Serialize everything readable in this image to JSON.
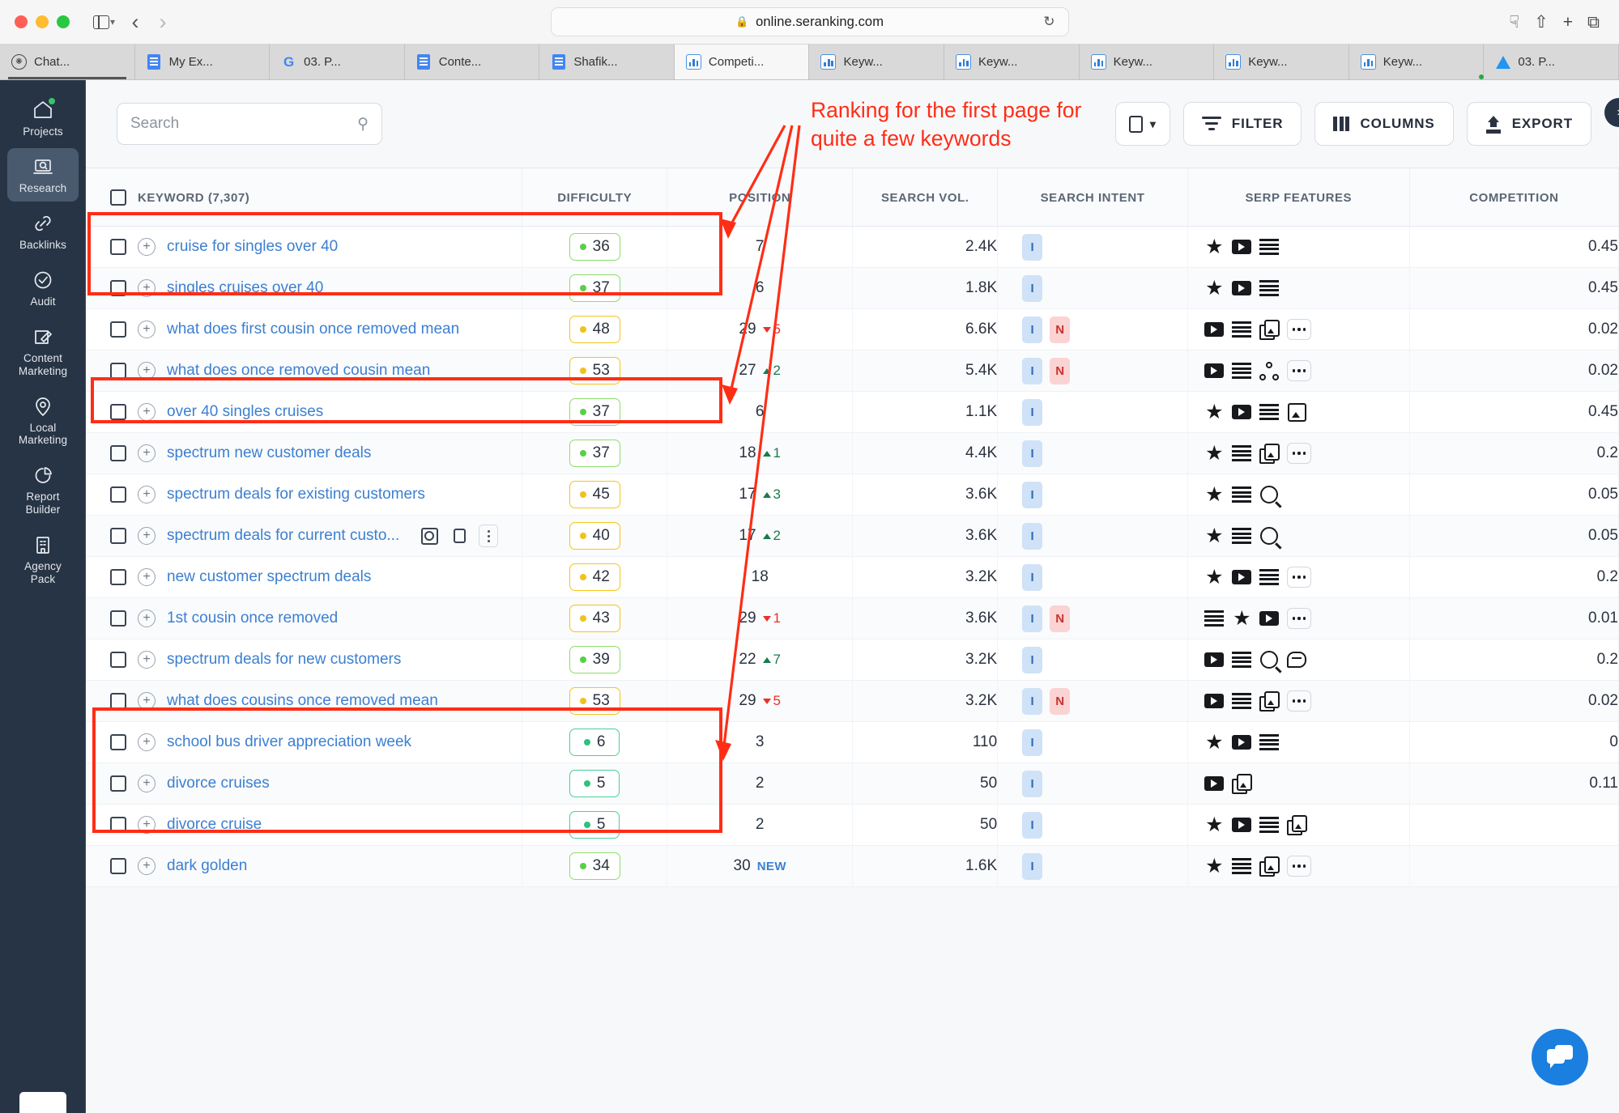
{
  "browser": {
    "url": "online.seranking.com",
    "lock_icon": "lock-icon",
    "reload_icon": "reload-icon",
    "download_icon": "download-icon",
    "share_icon": "share-icon",
    "new_tab_icon": "plus-icon",
    "tabs_overview_icon": "tabs-overview-icon",
    "back_icon": "back-arrow-icon",
    "forward_icon": "forward-arrow-icon",
    "sidebar_icon": "sidebar-toggle-icon",
    "tabs": [
      {
        "label": "Chat...",
        "favicon": "chatgpt-icon",
        "active": false
      },
      {
        "label": "My Ex...",
        "favicon": "google-docs-icon",
        "active": false
      },
      {
        "label": "03. P...",
        "favicon": "google-icon",
        "active": false
      },
      {
        "label": "Conte...",
        "favicon": "google-docs-icon",
        "active": false
      },
      {
        "label": "Shafik...",
        "favicon": "google-docs-icon",
        "active": false
      },
      {
        "label": "Competi...",
        "favicon": "chart-icon",
        "active": true
      },
      {
        "label": "Keyw...",
        "favicon": "chart-icon",
        "active": false
      },
      {
        "label": "Keyw...",
        "favicon": "chart-icon",
        "active": false
      },
      {
        "label": "Keyw...",
        "favicon": "chart-icon",
        "active": false
      },
      {
        "label": "Keyw...",
        "favicon": "chart-icon",
        "active": false
      },
      {
        "label": "Keyw...",
        "favicon": "chart-icon",
        "active": false
      },
      {
        "label": "03. P...",
        "favicon": "google-drive-icon",
        "active": false
      }
    ]
  },
  "sidebar": {
    "collapse_icon": "chevron-right-icon",
    "items": [
      {
        "label": "Projects",
        "icon": "home-icon",
        "active": false,
        "dot": true
      },
      {
        "label": "Research",
        "icon": "research-icon",
        "active": true,
        "dot": false
      },
      {
        "label": "Backlinks",
        "icon": "link-icon",
        "active": false,
        "dot": false
      },
      {
        "label": "Audit",
        "icon": "check-circle-icon",
        "active": false,
        "dot": false
      },
      {
        "label": "Content\nMarketing",
        "icon": "edit-icon",
        "active": false,
        "dot": false
      },
      {
        "label": "Local\nMarketing",
        "icon": "map-pin-icon",
        "active": false,
        "dot": false
      },
      {
        "label": "Report\nBuilder",
        "icon": "pie-chart-icon",
        "active": false,
        "dot": false
      },
      {
        "label": "Agency\nPack",
        "icon": "building-icon",
        "active": false,
        "dot": false
      }
    ]
  },
  "toolbar": {
    "search_placeholder": "Search",
    "search_value": "",
    "search_icon": "search-icon",
    "device_toggle_icon": "device-icon",
    "device_chevron_icon": "chevron-down-icon",
    "filter_label": "FILTER",
    "filter_icon": "filter-icon",
    "columns_label": "COLUMNS",
    "columns_icon": "columns-icon",
    "export_label": "EXPORT",
    "export_icon": "upload-icon"
  },
  "annotation": {
    "text": "Ranking for the first page for\nquite a few keywords",
    "color": "#ff2d16"
  },
  "table": {
    "headers": {
      "keyword": "KEYWORD  (7,307)",
      "difficulty": "DIFFICULTY",
      "position": "POSITION",
      "search_vol": "SEARCH VOL.",
      "search_intent": "SEARCH INTENT",
      "serp_features": "SERP FEATURES",
      "competition": "COMPETITION"
    },
    "select_all_checkbox": "unchecked",
    "rows": [
      {
        "keyword": "cruise for singles over 40",
        "difficulty": "36",
        "diff_level": "green",
        "position": "7",
        "delta": "",
        "delta_dir": "",
        "new": false,
        "volume": "2.4K",
        "intents": [
          "I"
        ],
        "serp": [
          "star",
          "video",
          "lines"
        ],
        "competition": "0.45",
        "tools": false
      },
      {
        "keyword": "singles cruises over 40",
        "difficulty": "37",
        "diff_level": "green",
        "position": "6",
        "delta": "",
        "delta_dir": "",
        "new": false,
        "volume": "1.8K",
        "intents": [
          "I"
        ],
        "serp": [
          "star",
          "video",
          "lines"
        ],
        "competition": "0.45",
        "tools": false
      },
      {
        "keyword": "what does first cousin once removed mean",
        "difficulty": "48",
        "diff_level": "yellow",
        "position": "29",
        "delta": "5",
        "delta_dir": "down",
        "new": false,
        "volume": "6.6K",
        "intents": [
          "I",
          "N"
        ],
        "serp": [
          "video",
          "lines",
          "imgstack",
          "more"
        ],
        "competition": "0.02",
        "tools": false
      },
      {
        "keyword": "what does once removed cousin mean",
        "difficulty": "53",
        "diff_level": "yellow",
        "position": "27",
        "delta": "2",
        "delta_dir": "up",
        "new": false,
        "volume": "5.4K",
        "intents": [
          "I",
          "N"
        ],
        "serp": [
          "video",
          "lines",
          "sitelinks",
          "more"
        ],
        "competition": "0.02",
        "tools": false
      },
      {
        "keyword": "over 40 singles cruises",
        "difficulty": "37",
        "diff_level": "green",
        "position": "6",
        "delta": "",
        "delta_dir": "",
        "new": false,
        "volume": "1.1K",
        "intents": [
          "I"
        ],
        "serp": [
          "star",
          "video",
          "lines",
          "img"
        ],
        "competition": "0.45",
        "tools": false
      },
      {
        "keyword": "spectrum new customer deals",
        "difficulty": "37",
        "diff_level": "green",
        "position": "18",
        "delta": "1",
        "delta_dir": "up",
        "new": false,
        "volume": "4.4K",
        "intents": [
          "I"
        ],
        "serp": [
          "star",
          "lines",
          "imgstack",
          "more"
        ],
        "competition": "0.2",
        "tools": false
      },
      {
        "keyword": "spectrum deals for existing customers",
        "difficulty": "45",
        "diff_level": "yellow",
        "position": "17",
        "delta": "3",
        "delta_dir": "up",
        "new": false,
        "volume": "3.6K",
        "intents": [
          "I"
        ],
        "serp": [
          "star",
          "lines",
          "search"
        ],
        "competition": "0.05",
        "tools": false
      },
      {
        "keyword": "spectrum deals for current custo...",
        "difficulty": "40",
        "diff_level": "yellow",
        "position": "17",
        "delta": "2",
        "delta_dir": "up",
        "new": false,
        "volume": "3.6K",
        "intents": [
          "I"
        ],
        "serp": [
          "star",
          "lines",
          "search"
        ],
        "competition": "0.05",
        "tools": true
      },
      {
        "keyword": "new customer spectrum deals",
        "difficulty": "42",
        "diff_level": "yellow",
        "position": "18",
        "delta": "",
        "delta_dir": "",
        "new": false,
        "volume": "3.2K",
        "intents": [
          "I"
        ],
        "serp": [
          "star",
          "video",
          "lines",
          "more"
        ],
        "competition": "0.2",
        "tools": false
      },
      {
        "keyword": "1st cousin once removed",
        "difficulty": "43",
        "diff_level": "yellow",
        "position": "29",
        "delta": "1",
        "delta_dir": "down",
        "new": false,
        "volume": "3.6K",
        "intents": [
          "I",
          "N"
        ],
        "serp": [
          "lines",
          "star",
          "video",
          "more"
        ],
        "competition": "0.01",
        "tools": false
      },
      {
        "keyword": "spectrum deals for new customers",
        "difficulty": "39",
        "diff_level": "green",
        "position": "22",
        "delta": "7",
        "delta_dir": "up",
        "new": false,
        "volume": "3.2K",
        "intents": [
          "I"
        ],
        "serp": [
          "video",
          "lines",
          "search",
          "chat"
        ],
        "competition": "0.2",
        "tools": false
      },
      {
        "keyword": "what does cousins once removed mean",
        "difficulty": "53",
        "diff_level": "yellow",
        "position": "29",
        "delta": "5",
        "delta_dir": "down",
        "new": false,
        "volume": "3.2K",
        "intents": [
          "I",
          "N"
        ],
        "serp": [
          "video",
          "lines",
          "imgstack",
          "more"
        ],
        "competition": "0.02",
        "tools": false
      },
      {
        "keyword": "school bus driver appreciation week",
        "difficulty": "6",
        "diff_level": "teal",
        "position": "3",
        "delta": "",
        "delta_dir": "",
        "new": false,
        "volume": "110",
        "intents": [
          "I"
        ],
        "serp": [
          "star",
          "video",
          "lines"
        ],
        "competition": "0",
        "tools": false
      },
      {
        "keyword": "divorce cruises",
        "difficulty": "5",
        "diff_level": "teal",
        "position": "2",
        "delta": "",
        "delta_dir": "",
        "new": false,
        "volume": "50",
        "intents": [
          "I"
        ],
        "serp": [
          "video",
          "imgstack"
        ],
        "competition": "0.11",
        "tools": false
      },
      {
        "keyword": "divorce cruise",
        "difficulty": "5",
        "diff_level": "teal",
        "position": "2",
        "delta": "",
        "delta_dir": "",
        "new": false,
        "volume": "50",
        "intents": [
          "I"
        ],
        "serp": [
          "star",
          "video",
          "lines",
          "imgstack"
        ],
        "competition": "",
        "tools": false
      },
      {
        "keyword": "dark golden",
        "difficulty": "34",
        "diff_level": "green",
        "position": "30",
        "delta": "",
        "delta_dir": "",
        "new": true,
        "volume": "1.6K",
        "intents": [
          "I"
        ],
        "serp": [
          "star",
          "lines",
          "imgstack",
          "more"
        ],
        "competition": "",
        "tools": false
      }
    ]
  },
  "chat_widget": {
    "icon": "chat-icon"
  }
}
